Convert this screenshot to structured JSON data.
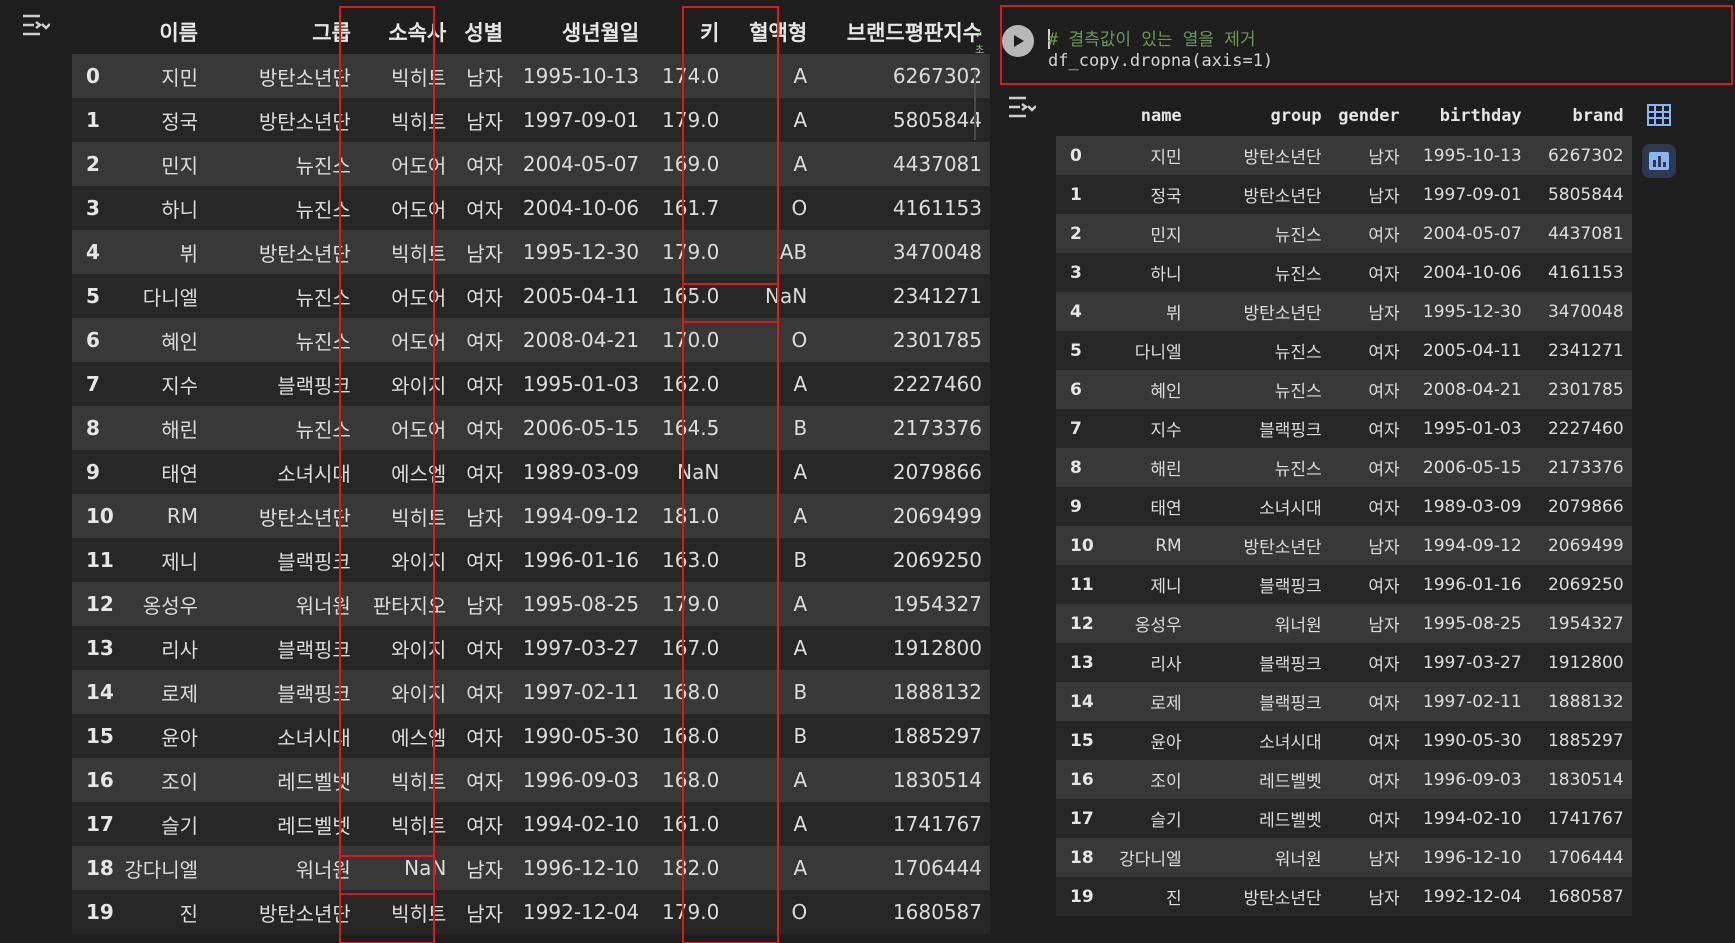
{
  "left": {
    "columns": [
      "",
      "이름",
      "그룹",
      "소속사",
      "성별",
      "생년월일",
      "키",
      "혈액형",
      "브랜드평판지수"
    ],
    "rows": [
      [
        "0",
        "지민",
        "방탄소년단",
        "빅히트",
        "남자",
        "1995-10-13",
        "174.0",
        "A",
        "6267302"
      ],
      [
        "1",
        "정국",
        "방탄소년단",
        "빅히트",
        "남자",
        "1997-09-01",
        "179.0",
        "A",
        "5805844"
      ],
      [
        "2",
        "민지",
        "뉴진스",
        "어도어",
        "여자",
        "2004-05-07",
        "169.0",
        "A",
        "4437081"
      ],
      [
        "3",
        "하니",
        "뉴진스",
        "어도어",
        "여자",
        "2004-10-06",
        "161.7",
        "O",
        "4161153"
      ],
      [
        "4",
        "뷔",
        "방탄소년단",
        "빅히트",
        "남자",
        "1995-12-30",
        "179.0",
        "AB",
        "3470048"
      ],
      [
        "5",
        "다니엘",
        "뉴진스",
        "어도어",
        "여자",
        "2005-04-11",
        "165.0",
        "NaN",
        "2341271"
      ],
      [
        "6",
        "혜인",
        "뉴진스",
        "어도어",
        "여자",
        "2008-04-21",
        "170.0",
        "O",
        "2301785"
      ],
      [
        "7",
        "지수",
        "블랙핑크",
        "와이지",
        "여자",
        "1995-01-03",
        "162.0",
        "A",
        "2227460"
      ],
      [
        "8",
        "해린",
        "뉴진스",
        "어도어",
        "여자",
        "2006-05-15",
        "164.5",
        "B",
        "2173376"
      ],
      [
        "9",
        "태연",
        "소녀시대",
        "에스엠",
        "여자",
        "1989-03-09",
        "NaN",
        "A",
        "2079866"
      ],
      [
        "10",
        "RM",
        "방탄소년단",
        "빅히트",
        "남자",
        "1994-09-12",
        "181.0",
        "A",
        "2069499"
      ],
      [
        "11",
        "제니",
        "블랙핑크",
        "와이지",
        "여자",
        "1996-01-16",
        "163.0",
        "B",
        "2069250"
      ],
      [
        "12",
        "옹성우",
        "워너원",
        "판타지오",
        "남자",
        "1995-08-25",
        "179.0",
        "A",
        "1954327"
      ],
      [
        "13",
        "리사",
        "블랙핑크",
        "와이지",
        "여자",
        "1997-03-27",
        "167.0",
        "A",
        "1912800"
      ],
      [
        "14",
        "로제",
        "블랙핑크",
        "와이지",
        "여자",
        "1997-02-11",
        "168.0",
        "B",
        "1888132"
      ],
      [
        "15",
        "윤아",
        "소녀시대",
        "에스엠",
        "여자",
        "1990-05-30",
        "168.0",
        "B",
        "1885297"
      ],
      [
        "16",
        "조이",
        "레드벨벳",
        "빅히트",
        "여자",
        "1996-09-03",
        "168.0",
        "A",
        "1830514"
      ],
      [
        "17",
        "슬기",
        "레드벨벳",
        "빅히트",
        "여자",
        "1994-02-10",
        "161.0",
        "A",
        "1741767"
      ],
      [
        "18",
        "강다니엘",
        "워너원",
        "NaN",
        "남자",
        "1996-12-10",
        "182.0",
        "A",
        "1706444"
      ],
      [
        "19",
        "진",
        "방탄소년단",
        "빅히트",
        "남자",
        "1992-12-04",
        "179.0",
        "O",
        "1680587"
      ]
    ]
  },
  "right": {
    "code_comment": "# 결측값이 있는 열을 제거",
    "code_line": "df_copy.dropna(axis=1)",
    "columns": [
      "",
      "name",
      "group",
      "gender",
      "birthday",
      "brand"
    ],
    "rows": [
      [
        "0",
        "지민",
        "방탄소년단",
        "남자",
        "1995-10-13",
        "6267302"
      ],
      [
        "1",
        "정국",
        "방탄소년단",
        "남자",
        "1997-09-01",
        "5805844"
      ],
      [
        "2",
        "민지",
        "뉴진스",
        "여자",
        "2004-05-07",
        "4437081"
      ],
      [
        "3",
        "하니",
        "뉴진스",
        "여자",
        "2004-10-06",
        "4161153"
      ],
      [
        "4",
        "뷔",
        "방탄소년단",
        "남자",
        "1995-12-30",
        "3470048"
      ],
      [
        "5",
        "다니엘",
        "뉴진스",
        "여자",
        "2005-04-11",
        "2341271"
      ],
      [
        "6",
        "혜인",
        "뉴진스",
        "여자",
        "2008-04-21",
        "2301785"
      ],
      [
        "7",
        "지수",
        "블랙핑크",
        "여자",
        "1995-01-03",
        "2227460"
      ],
      [
        "8",
        "해린",
        "뉴진스",
        "여자",
        "2006-05-15",
        "2173376"
      ],
      [
        "9",
        "태연",
        "소녀시대",
        "여자",
        "1989-03-09",
        "2079866"
      ],
      [
        "10",
        "RM",
        "방탄소년단",
        "남자",
        "1994-09-12",
        "2069499"
      ],
      [
        "11",
        "제니",
        "블랙핑크",
        "여자",
        "1996-01-16",
        "2069250"
      ],
      [
        "12",
        "옹성우",
        "워너원",
        "남자",
        "1995-08-25",
        "1954327"
      ],
      [
        "13",
        "리사",
        "블랙핑크",
        "여자",
        "1997-03-27",
        "1912800"
      ],
      [
        "14",
        "로제",
        "블랙핑크",
        "여자",
        "1997-02-11",
        "1888132"
      ],
      [
        "15",
        "윤아",
        "소녀시대",
        "여자",
        "1990-05-30",
        "1885297"
      ],
      [
        "16",
        "조이",
        "레드벨벳",
        "여자",
        "1996-09-03",
        "1830514"
      ],
      [
        "17",
        "슬기",
        "레드벨벳",
        "여자",
        "1994-02-10",
        "1741767"
      ],
      [
        "18",
        "강다니엘",
        "워너원",
        "남자",
        "1996-12-10",
        "1706444"
      ],
      [
        "19",
        "진",
        "방탄소년단",
        "남자",
        "1992-12-04",
        "1680587"
      ]
    ]
  },
  "colors": {
    "highlight": "#e01818",
    "comment": "#6a9955",
    "background": "#1e1e1e",
    "row_alt": "#383838"
  },
  "icons": {
    "output_toggle": "output-collapse-icon",
    "run": "play-icon",
    "table_view": "table-icon",
    "chart_view": "chart-icon"
  }
}
